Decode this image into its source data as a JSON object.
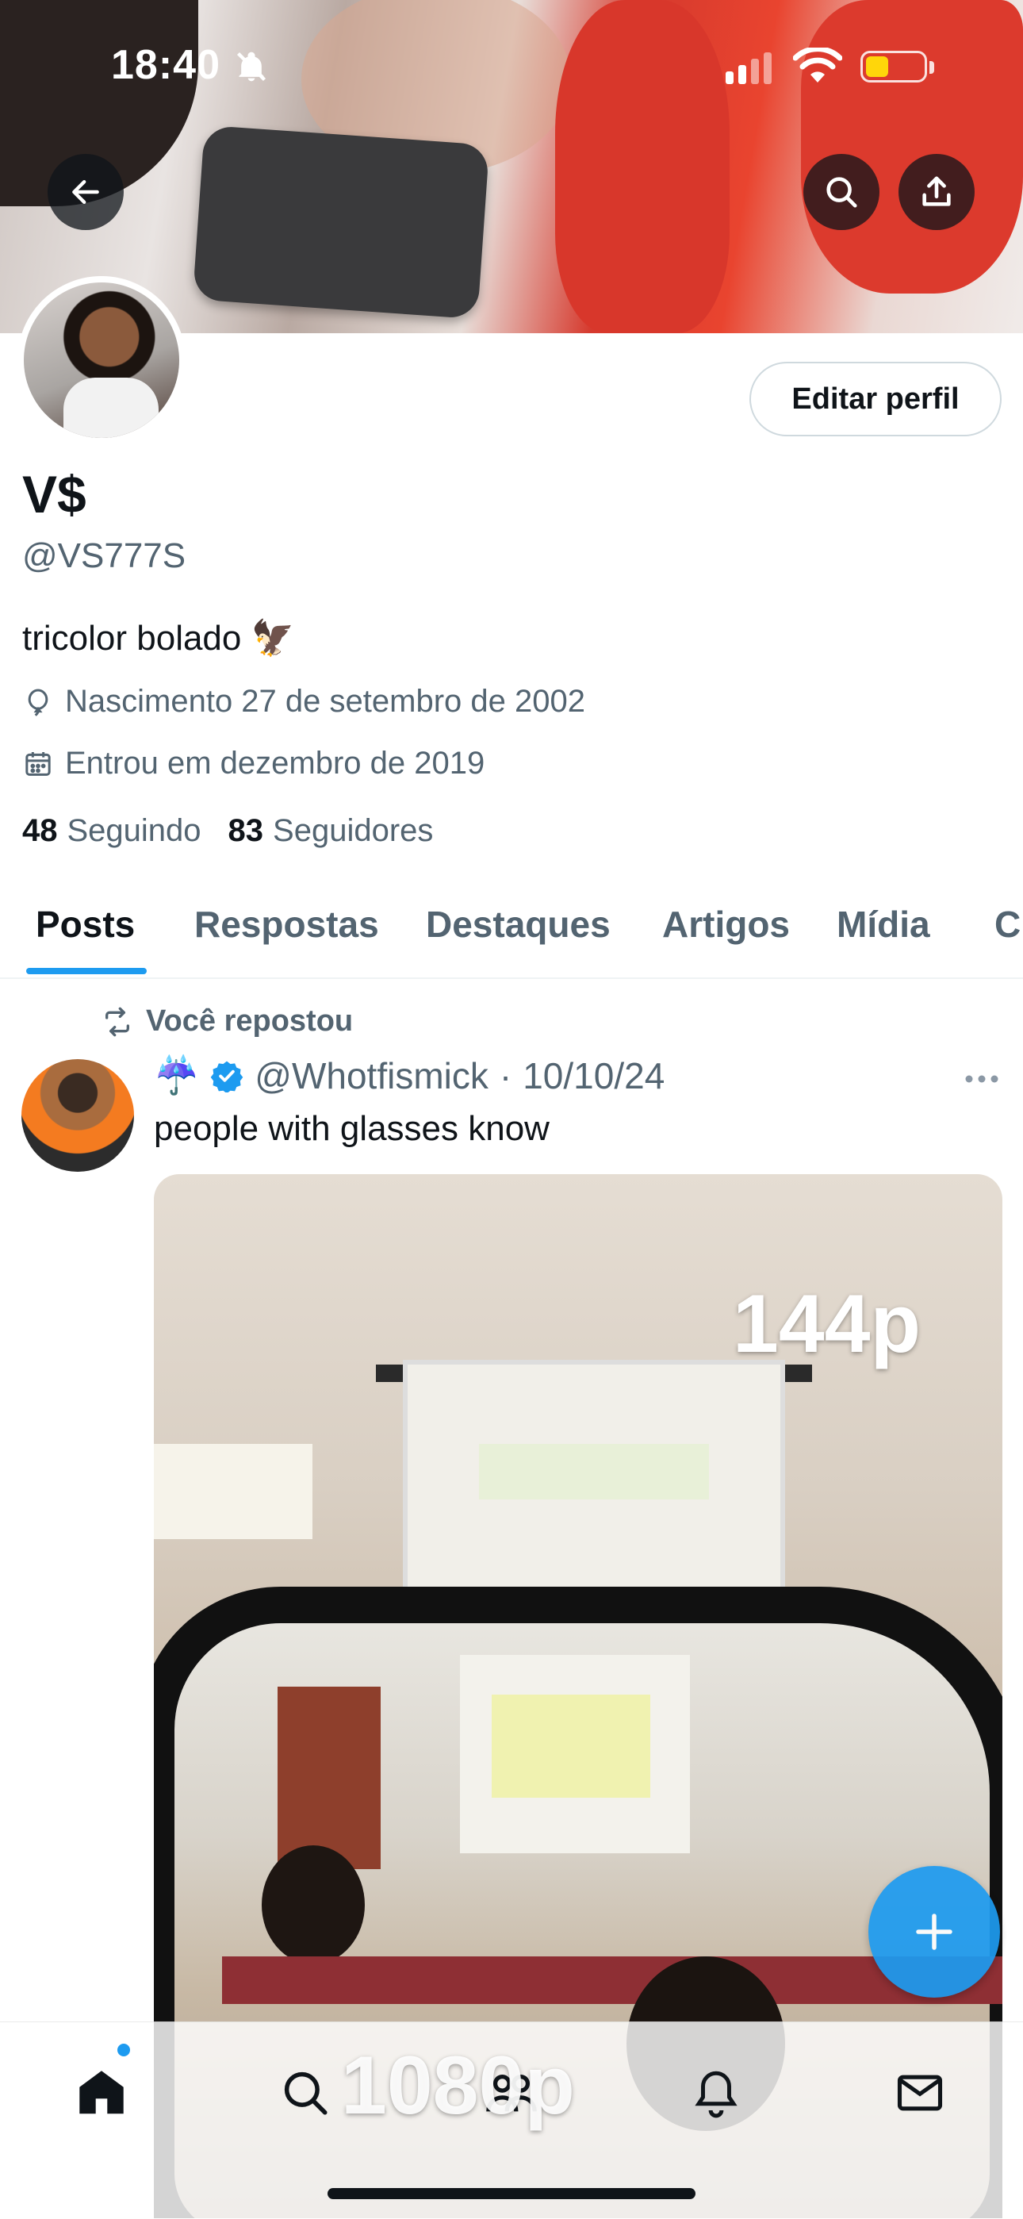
{
  "status_bar": {
    "time": "18:40"
  },
  "header": {
    "back_icon": "arrow-left-icon",
    "search_icon": "search-icon",
    "share_icon": "share-icon"
  },
  "profile": {
    "display_name": "V$",
    "handle": "@VS777S",
    "bio": "tricolor bolado 🦅",
    "birthday": "Nascimento 27 de setembro de 2002",
    "joined": "Entrou em dezembro de 2019",
    "following_count": "48",
    "following_label": "Seguindo",
    "followers_count": "83",
    "followers_label": "Seguidores",
    "edit_button": "Editar perfil"
  },
  "tabs": [
    {
      "label": "Posts",
      "active": true
    },
    {
      "label": "Respostas",
      "active": false
    },
    {
      "label": "Destaques",
      "active": false
    },
    {
      "label": "Artigos",
      "active": false
    },
    {
      "label": "Mídia",
      "active": false
    },
    {
      "label": "C",
      "active": false
    }
  ],
  "post": {
    "repost_label": "Você repostou",
    "author_emoji": "☔",
    "author_handle": "@Whotfismick",
    "separator": "·",
    "date": "10/10/24",
    "text": "people with glasses know",
    "media_labels": {
      "top": "144p",
      "bottom": "1080p"
    }
  },
  "bottom_nav": [
    "home-icon",
    "search-icon",
    "communities-icon",
    "notifications-icon",
    "messages-icon"
  ],
  "colors": {
    "accent": "#1d9bf0",
    "text_primary": "#0f1419",
    "text_secondary": "#536471"
  }
}
